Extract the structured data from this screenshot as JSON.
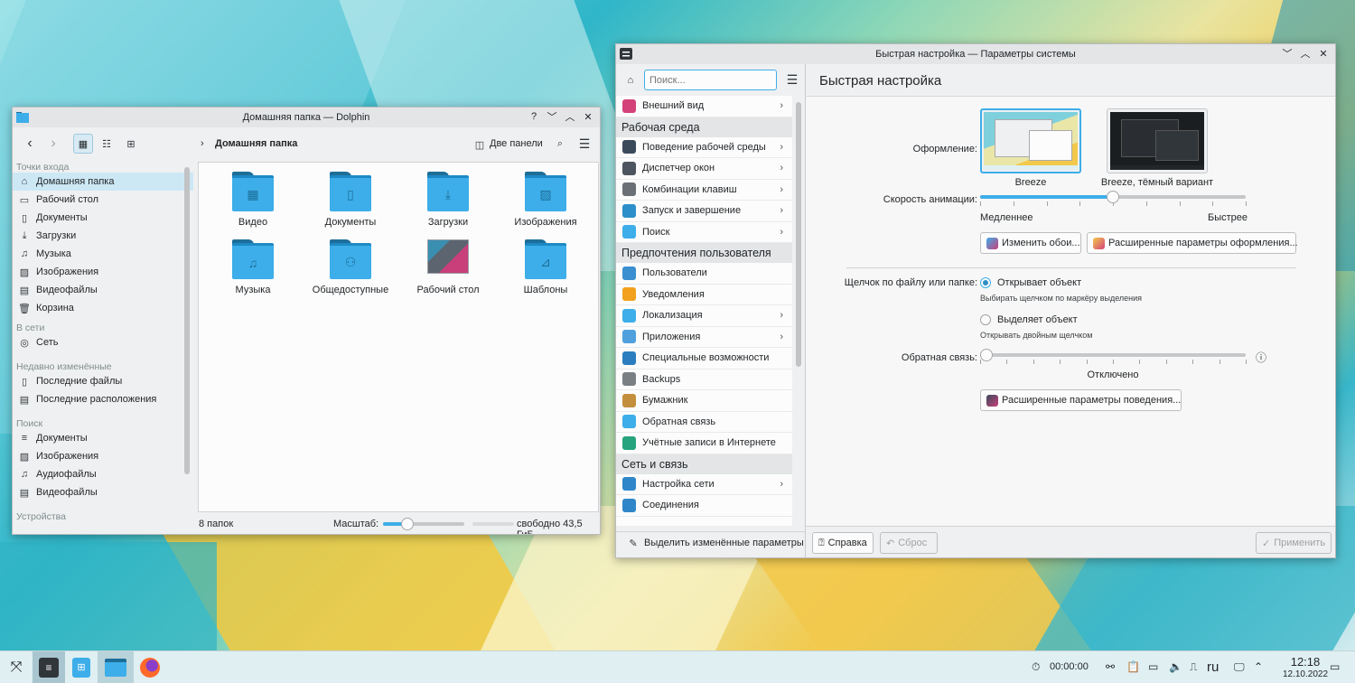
{
  "dolphin": {
    "title": "Домашняя папка — Dolphin",
    "breadcrumb": "Домашняя папка",
    "split_label": "Две панели",
    "places_header": "Точки входа",
    "places": [
      "Домашняя папка",
      "Рабочий стол",
      "Документы",
      "Загрузки",
      "Музыка",
      "Изображения",
      "Видеофайлы",
      "Корзина"
    ],
    "network_header": "В сети",
    "network": [
      "Сеть"
    ],
    "recent_header": "Недавно изменённые",
    "recent": [
      "Последние файлы",
      "Последние расположения"
    ],
    "search_header": "Поиск",
    "search": [
      "Документы",
      "Изображения",
      "Аудиофайлы",
      "Видеофайлы"
    ],
    "devices_header": "Устройства",
    "folders": [
      "Видео",
      "Документы",
      "Загрузки",
      "Изображения",
      "Музыка",
      "Общедоступные",
      "Рабочий стол",
      "Шаблоны"
    ],
    "status_count": "8 папок",
    "zoom_label": "Масштаб:",
    "zoom_level": 0.3,
    "free_space": "свободно 43,5 ГиБ",
    "free_fraction": 0.0
  },
  "settings": {
    "title": "Быстрая настройка — Параметры системы",
    "search_placeholder": "Поиск...",
    "page_title": "Быстрая настройка",
    "sidebar": [
      {
        "type": "item",
        "label": "Внешний вид",
        "chev": true,
        "color": "#d4427a"
      },
      {
        "type": "cat",
        "label": "Рабочая среда"
      },
      {
        "type": "item",
        "label": "Поведение рабочей среды",
        "chev": true,
        "color": "#3b4a5a"
      },
      {
        "type": "item",
        "label": "Диспетчер окон",
        "chev": true,
        "color": "#4d5560"
      },
      {
        "type": "item",
        "label": "Комбинации клавиш",
        "chev": true,
        "color": "#6b7076"
      },
      {
        "type": "item",
        "label": "Запуск и завершение",
        "chev": true,
        "color": "#2c8fc9"
      },
      {
        "type": "item",
        "label": "Поиск",
        "chev": true,
        "color": "#3daee9"
      },
      {
        "type": "cat",
        "label": "Предпочтения пользователя"
      },
      {
        "type": "item",
        "label": "Пользователи",
        "chev": false,
        "color": "#3a8fd0"
      },
      {
        "type": "item",
        "label": "Уведомления",
        "chev": false,
        "color": "#f2a11e"
      },
      {
        "type": "item",
        "label": "Локализация",
        "chev": true,
        "color": "#3daee9"
      },
      {
        "type": "item",
        "label": "Приложения",
        "chev": true,
        "color": "#4fa0dd"
      },
      {
        "type": "item",
        "label": "Специальные возможности",
        "chev": false,
        "color": "#2a7ec0"
      },
      {
        "type": "item",
        "label": "Backups",
        "chev": false,
        "color": "#7a7f84"
      },
      {
        "type": "item",
        "label": "Бумажник",
        "chev": false,
        "color": "#c48f3c"
      },
      {
        "type": "item",
        "label": "Обратная связь",
        "chev": false,
        "color": "#3daee9"
      },
      {
        "type": "item",
        "label": "Учётные записи в Интернете",
        "chev": false,
        "color": "#27a37d"
      },
      {
        "type": "cat",
        "label": "Сеть и связь"
      },
      {
        "type": "item",
        "label": "Настройка сети",
        "chev": true,
        "color": "#2f86c9"
      },
      {
        "type": "item",
        "label": "Соединения",
        "chev": false,
        "color": "#2f86c9"
      }
    ],
    "highlight_label": "Выделить изменённые параметры",
    "theme_label": "Оформление:",
    "themes": [
      "Breeze",
      "Breeze, тёмный вариант"
    ],
    "anim_label": "Скорость анимации:",
    "anim_value": 0.5,
    "slower": "Медленнее",
    "faster": "Быстрее",
    "wallpaper_btn": "Изменить обои...",
    "appearance_btn": "Расширенные параметры оформления...",
    "click_label": "Щелчок по файлу или папке:",
    "click_opt1": "Открывает объект",
    "click_opt1_hint": "Выбирать щелчком по маркёру выделения",
    "click_opt2": "Выделяет объект",
    "click_opt2_hint": "Открывать двойным щелчком",
    "feedback_label": "Обратная связь:",
    "feedback_value": "Отключено",
    "feedback_level": 0.0,
    "behavior_btn": "Расширенные параметры поведения...",
    "help_btn": "Справка",
    "reset_btn": "Сброс",
    "apply_btn": "Применить"
  },
  "taskbar": {
    "timer": "00:00:00",
    "lang": "ru",
    "time": "12:18",
    "date": "12.10.2022"
  }
}
